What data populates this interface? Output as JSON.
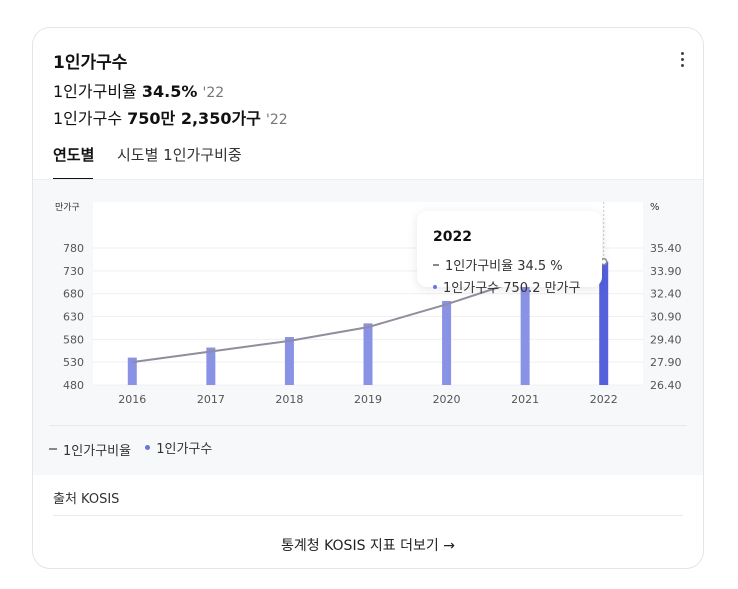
{
  "card": {
    "title": "1인가구수",
    "stat1": {
      "label": "1인가구비율",
      "value": "34.5%",
      "year": "'22"
    },
    "stat2": {
      "label": "1인가구수",
      "value": "750만 2,350가구",
      "year": "'22"
    },
    "tabs": [
      "연도별",
      "시도별 1인가구비중"
    ],
    "source": "출처 KOSIS",
    "footer_link": "통계청 KOSIS 지표 더보기 →"
  },
  "chart_data": {
    "type": "bar",
    "categories": [
      "2016",
      "2017",
      "2018",
      "2019",
      "2020",
      "2021",
      "2022"
    ],
    "series": [
      {
        "name": "1인가구비율",
        "type": "line",
        "axis": "right",
        "unit": "%",
        "values": [
          27.9,
          28.6,
          29.3,
          30.2,
          31.7,
          33.4,
          34.5
        ],
        "color": "#8e8e9c"
      },
      {
        "name": "1인가구수",
        "type": "bar",
        "axis": "left",
        "unit": "만가구",
        "values": [
          540,
          562,
          585,
          615,
          664,
          716,
          750.2
        ],
        "color": "#8a92e6",
        "highlight_color": "#5561dc"
      }
    ],
    "left_axis": {
      "label": "만가구",
      "ticks": [
        "480",
        "530",
        "580",
        "630",
        "680",
        "730",
        "780"
      ],
      "range": [
        480,
        780
      ]
    },
    "right_axis": {
      "label": "%",
      "ticks": [
        "26.40",
        "27.90",
        "29.40",
        "30.90",
        "32.40",
        "33.90",
        "35.40"
      ],
      "range": [
        26.4,
        35.4
      ]
    },
    "tooltip": {
      "year": "2022",
      "line_text": "1인가구비율 34.5 %",
      "bar_text": "1인가구수 750.2 만가구"
    },
    "legend": [
      "1인가구비율",
      "1인가구수"
    ]
  }
}
